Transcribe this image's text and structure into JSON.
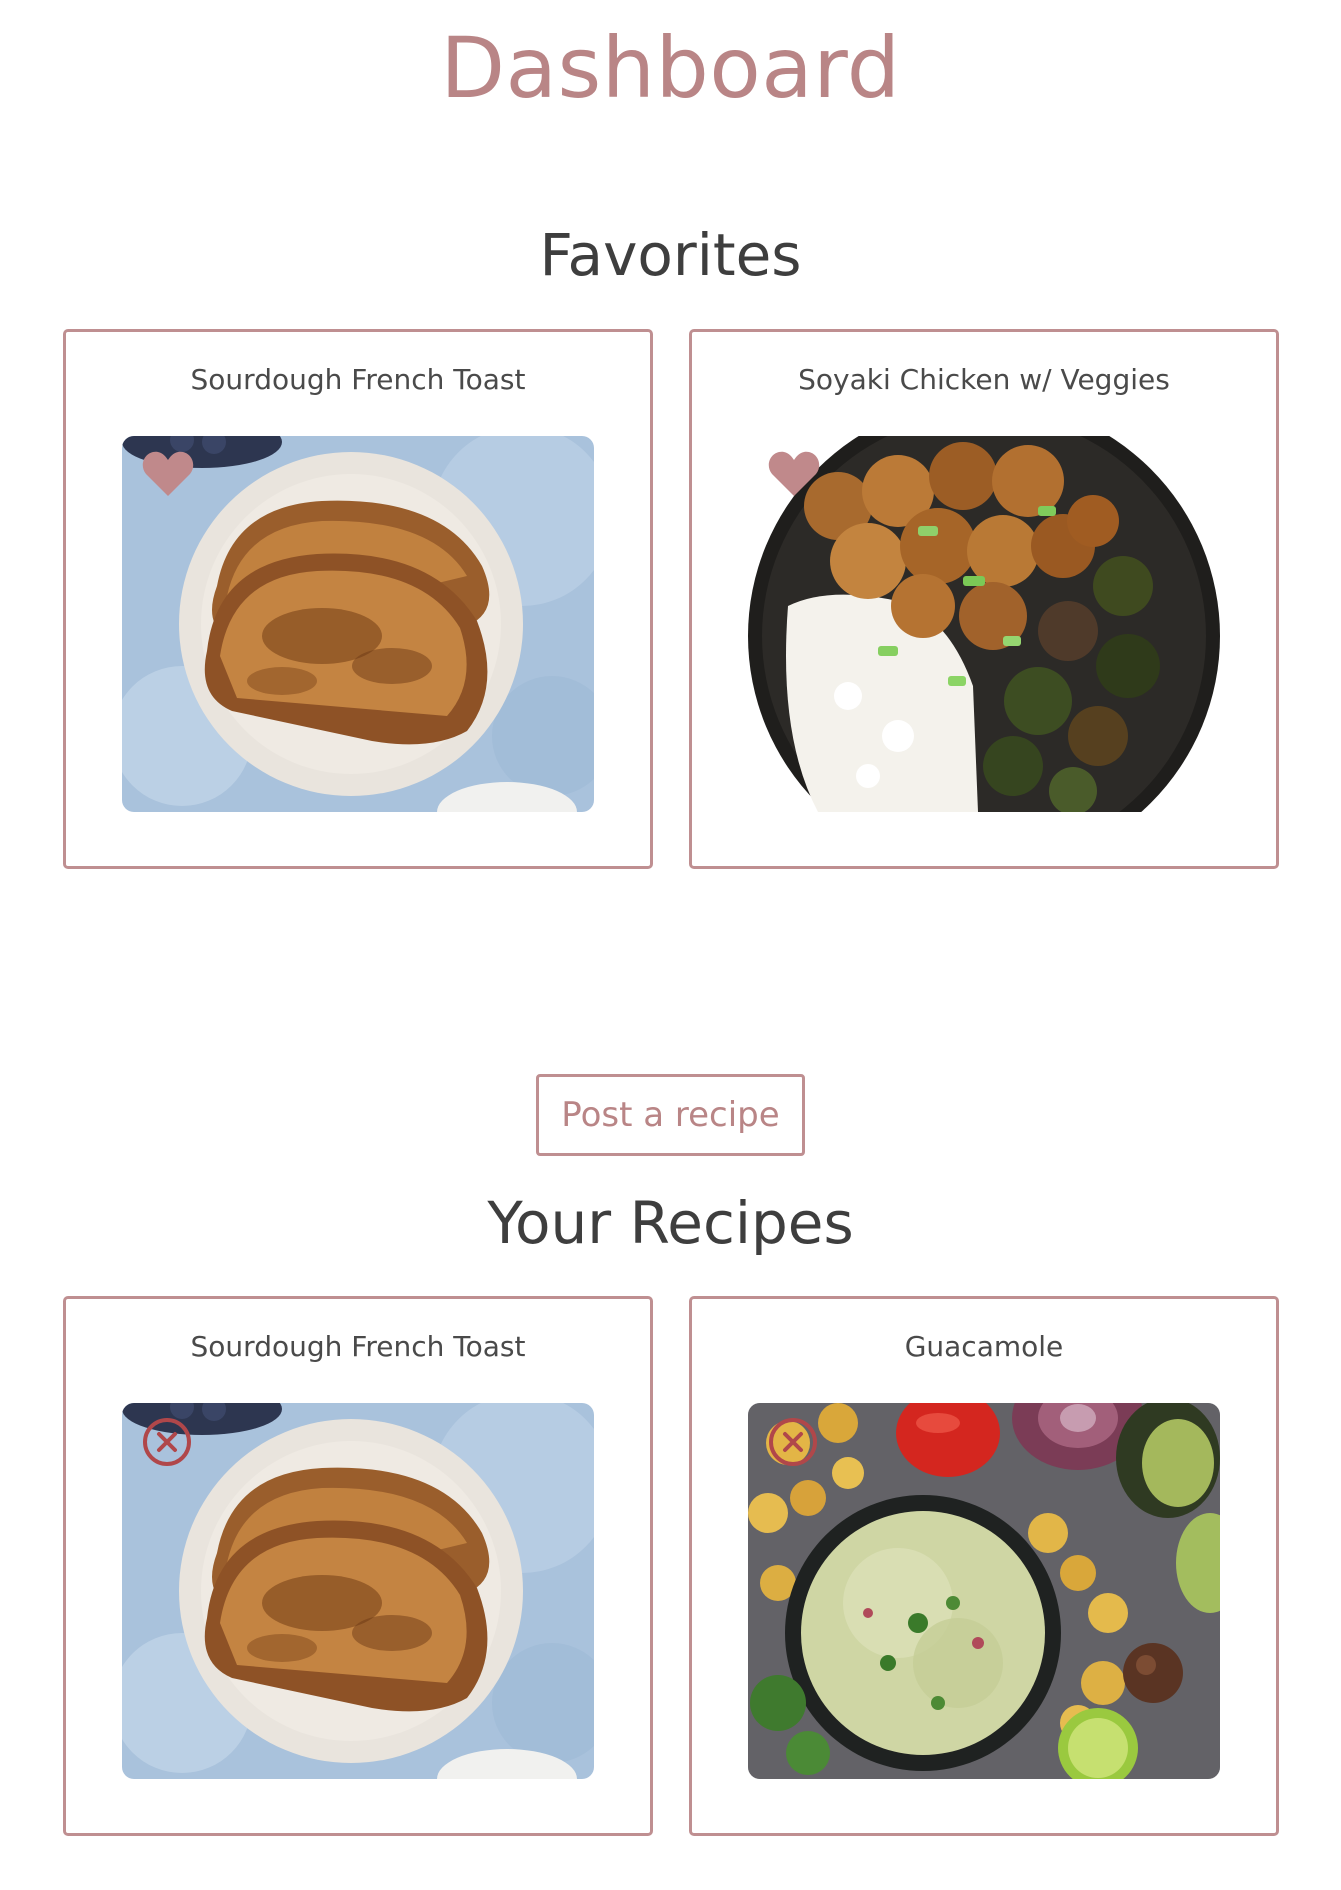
{
  "page": {
    "title": "Dashboard"
  },
  "favorites": {
    "heading": "Favorites",
    "items": [
      {
        "title": "Sourdough French Toast",
        "image": "french-toast-image",
        "action_icon": "heart-icon"
      },
      {
        "title": "Soyaki Chicken w/ Veggies",
        "image": "soyaki-chicken-image",
        "action_icon": "heart-icon"
      }
    ]
  },
  "post_button": {
    "label": "Post a recipe"
  },
  "your_recipes": {
    "heading": "Your Recipes",
    "items": [
      {
        "title": "Sourdough French Toast",
        "image": "french-toast-image",
        "action_icon": "remove-icon"
      },
      {
        "title": "Guacamole",
        "image": "guacamole-image",
        "action_icon": "remove-icon"
      }
    ]
  },
  "colors": {
    "accent": "#b98586",
    "card_border": "#bf8f91",
    "heading_text": "#3e3e3e",
    "remove_icon": "#b0474a"
  }
}
